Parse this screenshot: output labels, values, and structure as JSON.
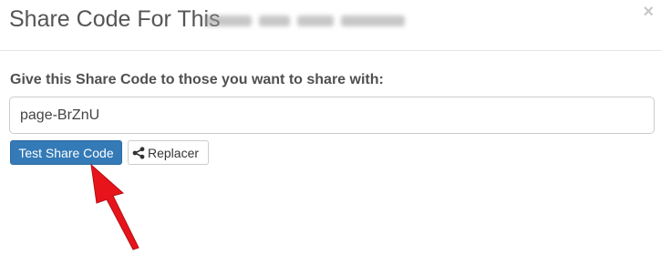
{
  "modal": {
    "title": "Share Code For This",
    "close_symbol": "×"
  },
  "form": {
    "label": "Give this Share Code to those you want to share with:",
    "share_code_value": "page-BrZnU"
  },
  "buttons": {
    "test_label": "Test Share Code",
    "replacer_label": "Replacer",
    "replacer_icon": "share-icon"
  },
  "colors": {
    "primary": "#337ab7",
    "arrow": "#e8141c"
  }
}
